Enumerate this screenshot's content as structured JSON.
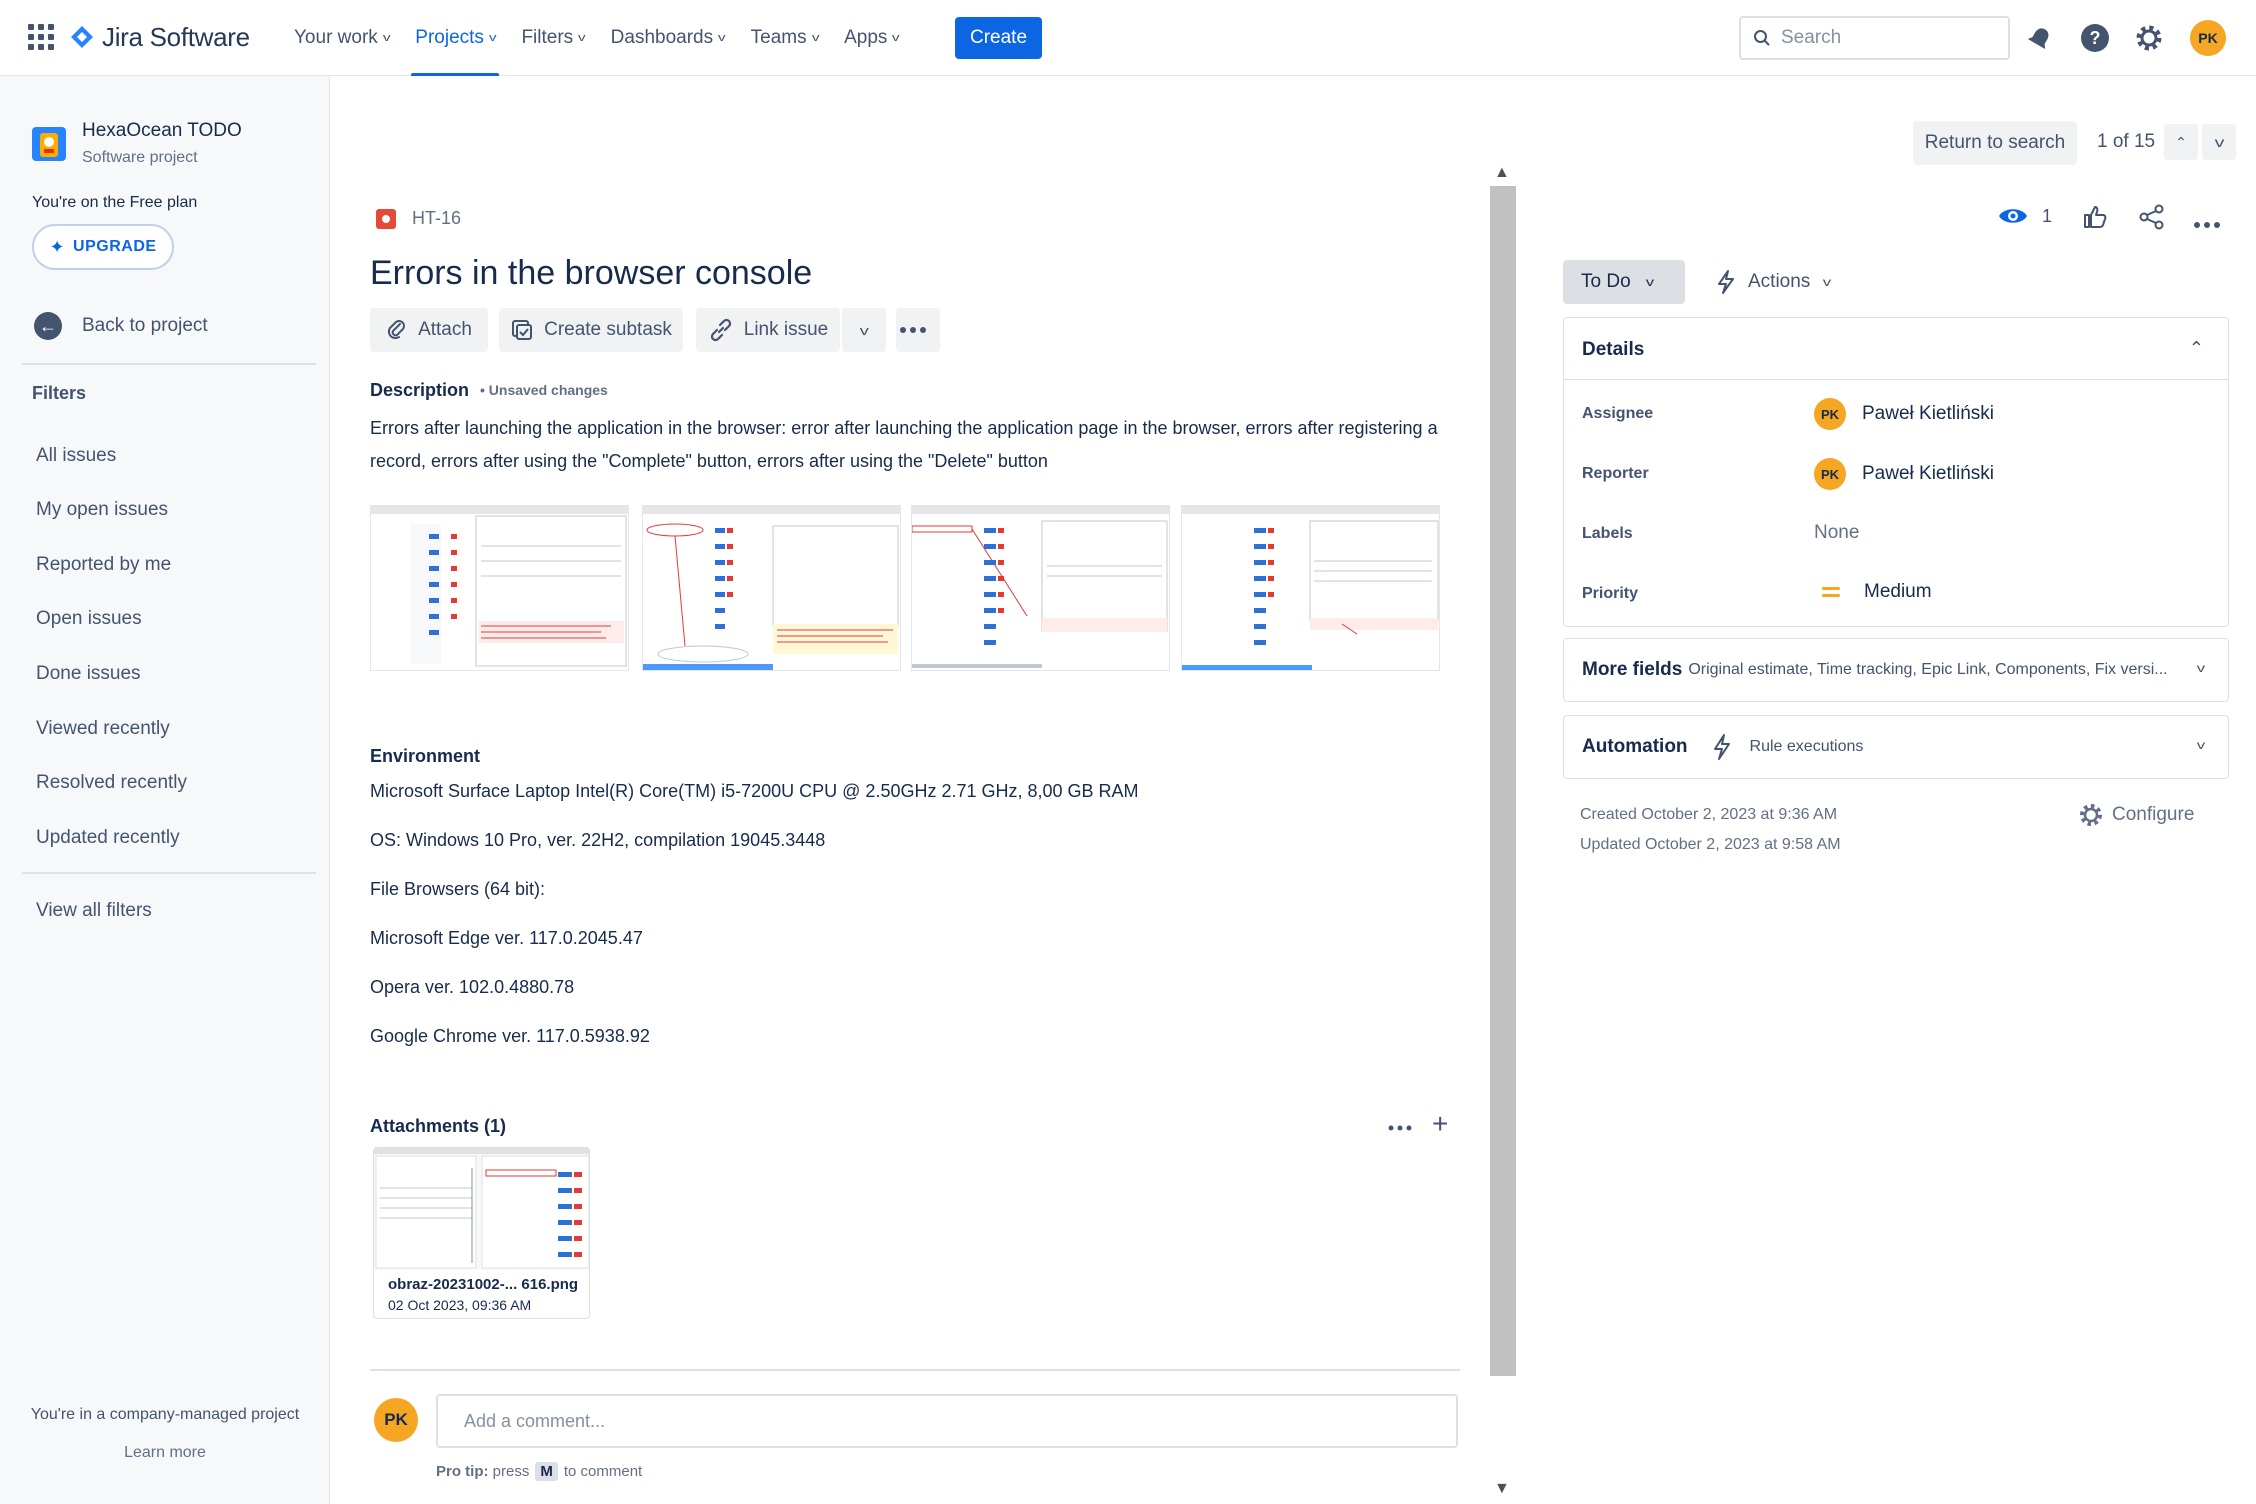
{
  "topbar": {
    "logo_text": "Jira Software",
    "nav": [
      {
        "label": "Your work",
        "active": false
      },
      {
        "label": "Projects",
        "active": true
      },
      {
        "label": "Filters",
        "active": false
      },
      {
        "label": "Dashboards",
        "active": false
      },
      {
        "label": "Teams",
        "active": false
      },
      {
        "label": "Apps",
        "active": false
      }
    ],
    "create_label": "Create",
    "search_placeholder": "Search",
    "user_initials": "PK",
    "icons": [
      "app-switcher-icon",
      "notifications-icon",
      "help-icon",
      "settings-icon"
    ],
    "accent_color": "#0c66e4"
  },
  "sidebar": {
    "project_name": "HexaOcean TODO",
    "project_type": "Software project",
    "plan_text": "You're on the Free plan",
    "upgrade_label": "UPGRADE",
    "back_label": "Back to project",
    "filters_title": "Filters",
    "filters": [
      "All issues",
      "My open issues",
      "Reported by me",
      "Open issues",
      "Done issues",
      "Viewed recently",
      "Resolved recently",
      "Updated recently"
    ],
    "view_all": "View all filters",
    "footer_text": "You're in a company-managed project",
    "learn_more": "Learn more"
  },
  "issue": {
    "key": "HT-16",
    "title": "Errors in the browser console",
    "buttons": {
      "attach": "Attach",
      "subtask": "Create subtask",
      "link": "Link issue"
    },
    "description_label": "Description",
    "unsaved": "• Unsaved changes",
    "description": "Errors after launching the application in the browser: error after launching the application page in the browser, errors after registering a record, errors after using the \"Complete\" button, errors after using the \"Delete\" button",
    "environment_label": "Environment",
    "environment": [
      "Microsoft Surface Laptop Intel(R) Core(TM) i5-7200U CPU @ 2.50GHz   2.71 GHz, 8,00 GB RAM",
      "OS: Windows 10 Pro, ver. 22H2, compilation 19045.3448",
      "File Browsers (64 bit):",
      "Microsoft Edge ver. 117.0.2045.47",
      "Opera ver. 102.0.4880.78",
      "Google Chrome ver. 117.0.5938.92"
    ],
    "attachments_label": "Attachments (1)",
    "attachment": {
      "name": "obraz-20231002-... 616.png",
      "date": "02 Oct 2023, 09:36 AM"
    },
    "comment_placeholder": "Add a comment...",
    "protip": {
      "prefix": "Pro tip:",
      "press": "press",
      "key": "M",
      "suffix": "to comment"
    }
  },
  "panel": {
    "return_label": "Return to search",
    "pager": "1 of 15",
    "watch_count": "1",
    "status": "To Do",
    "actions": "Actions",
    "details_title": "Details",
    "fields": {
      "assignee_label": "Assignee",
      "assignee": "Paweł Kietliński",
      "reporter_label": "Reporter",
      "reporter": "Paweł Kietliński",
      "labels_label": "Labels",
      "labels": "None",
      "priority_label": "Priority",
      "priority": "Medium"
    },
    "more_fields_title": "More fields",
    "more_fields_desc": "Original estimate, Time tracking, Epic Link, Components, Fix versi...",
    "automation_title": "Automation",
    "automation_desc": "Rule executions",
    "created": "Created October 2, 2023 at 9:36 AM",
    "updated": "Updated October 2, 2023 at 9:58 AM",
    "configure": "Configure",
    "priority_color": "#f5a623"
  }
}
